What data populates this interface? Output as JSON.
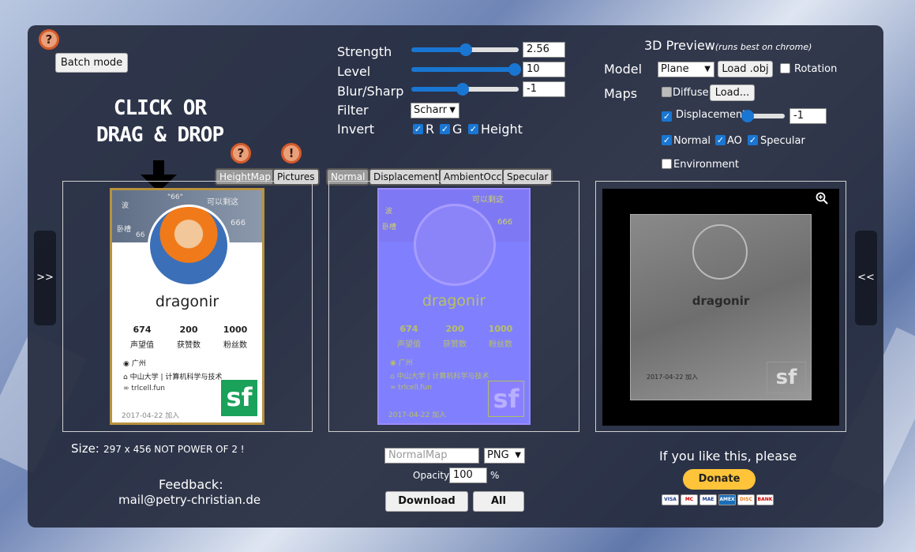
{
  "toolbar": {
    "help_glyph": "?",
    "warn_glyph": "!",
    "batch_mode_label": "Batch mode"
  },
  "drop_hint": {
    "line1": "CLICK OR",
    "line2": "DRAG & DROP"
  },
  "input_tabs": [
    "HeightMap",
    "Pictures"
  ],
  "output_tabs": [
    "Normal",
    "Displacement",
    "AmbientOcc",
    "Specular"
  ],
  "side_buttons": {
    "left": ">>",
    "right": "<<"
  },
  "controls": {
    "strength": {
      "label": "Strength",
      "value": "2.56",
      "fraction": 0.51
    },
    "level": {
      "label": "Level",
      "value": "10",
      "fraction": 0.96
    },
    "blur_sharp": {
      "label": "Blur/Sharp",
      "value": "-1",
      "fraction": 0.48
    },
    "filter": {
      "label": "Filter",
      "value": "Scharr"
    },
    "invert": {
      "label": "Invert",
      "r": "R",
      "g": "G",
      "height": "Height",
      "r_checked": true,
      "g_checked": true,
      "height_checked": true
    }
  },
  "preview3d": {
    "title": "3D Preview",
    "note": "(runs best on chrome)",
    "model_label": "Model",
    "model_value": "Plane",
    "load_obj_label": "Load .obj",
    "rotation_label": "Rotation",
    "rotation_checked": false,
    "maps_label": "Maps",
    "diffuse_label": "Diffuse",
    "diffuse_checked": false,
    "load_label": "Load...",
    "displacement_label": "Displacement",
    "displacement_checked": true,
    "displacement_value": "-1",
    "displacement_fraction": 0.05,
    "normal_label": "Normal",
    "ao_label": "AO",
    "specular_label": "Specular",
    "environment_label": "Environment",
    "environment_checked": false,
    "zoom_icon": "zoom-in-icon"
  },
  "card": {
    "name": "dragonir",
    "stats": [
      {
        "value": "674",
        "label": "声望值"
      },
      {
        "value": "200",
        "label": "获赞数"
      },
      {
        "value": "1000",
        "label": "粉丝数"
      }
    ],
    "location": "广州",
    "school": "中山大学 | 计算机科学与技术",
    "site": "trlcell.fun",
    "date": "2017-04-22 加入",
    "logo": "sf",
    "banner_text_1": "可以剩这",
    "banner_text_2": "666",
    "banner_text_3": "66",
    "banner_text_4": "\"66\"",
    "banner_text_5": "波",
    "banner_text_6": "卧槽"
  },
  "size_info": {
    "label": "Size:",
    "value": "297 x 456 NOT POWER OF 2 !"
  },
  "feedback": {
    "label": "Feedback:",
    "email": "mail@petry-christian.de"
  },
  "export": {
    "filename_placeholder": "NormalMap",
    "format": "PNG",
    "opacity_label": "Opacity",
    "opacity_value": "100",
    "opacity_unit": "%",
    "download_label": "Download",
    "all_label": "All"
  },
  "donate": {
    "text": "If you like this, please",
    "button_label": "Donate",
    "cards": [
      "VISA",
      "MC",
      "MAE",
      "AMEX",
      "DISC",
      "BANK"
    ]
  },
  "colors": {
    "panel_bg": "#262c40",
    "accent_blue": "#1976d2",
    "help_orange": "#d65a2a",
    "donate_yellow": "#ffc439",
    "normal_map_purple": "#8080ff",
    "card_border_gold": "#b8923f",
    "sf_green": "#1aa15a"
  }
}
